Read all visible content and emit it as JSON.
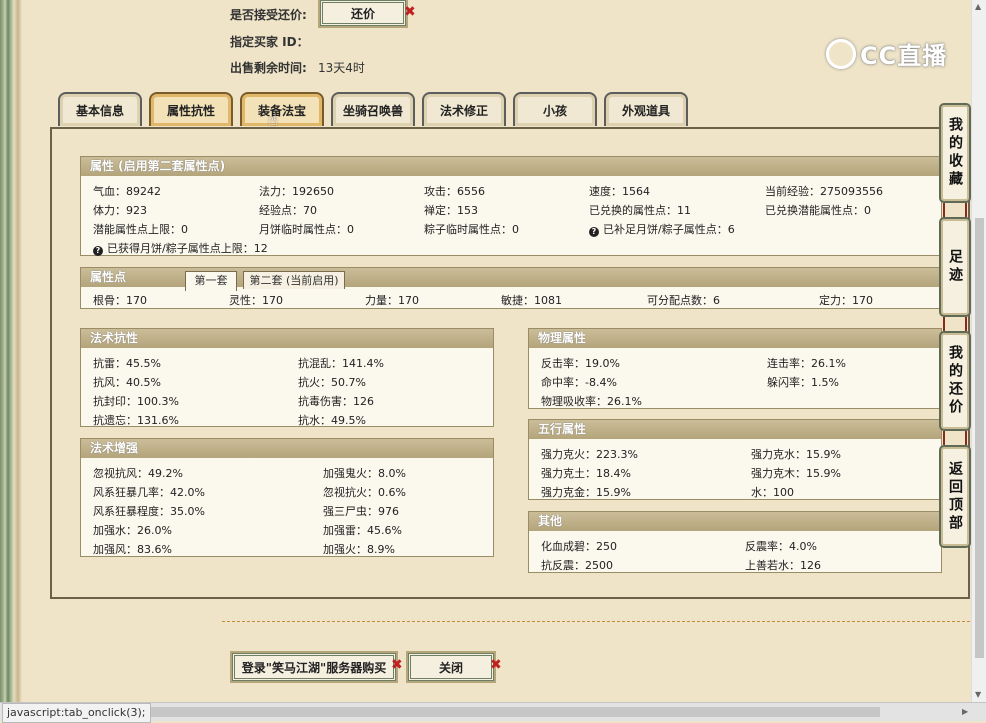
{
  "header": {
    "accept_counteroffer_label": "是否接受还价:",
    "counteroffer_button": "还价",
    "buyer_id_label": "指定买家 ID：",
    "remaining_time_label": "出售剩余时间:",
    "remaining_time_value": "13天4时"
  },
  "logo": {
    "text": "CC直播"
  },
  "tabs": [
    {
      "label": "基本信息"
    },
    {
      "label": "属性抗性"
    },
    {
      "label": "装备法宝"
    },
    {
      "label": "坐骑召唤兽"
    },
    {
      "label": "法术修正"
    },
    {
      "label": "小孩"
    },
    {
      "label": "外观道具"
    }
  ],
  "attributes": {
    "title": "属性 (启用第二套属性点)",
    "row1": [
      "气血：89242",
      "法力：192650",
      "攻击：6556",
      "速度：1564",
      "当前经验：275093556"
    ],
    "row2": [
      "体力：923",
      "经验点：70",
      "禅定：153",
      "已兑换的属性点：11",
      "已兑换潜能属性点：0"
    ],
    "row3": [
      "潜能属性点上限：0",
      "月饼临时属性点：0",
      "粽子临时属性点：0",
      "已补足月饼/粽子属性点：6"
    ],
    "row4": "已获得月饼/粽子属性点上限：12"
  },
  "attribute_points": {
    "title": "属性点",
    "subtab1": "第一套",
    "subtab2": "第二套 (当前启用)",
    "values": [
      "根骨：170",
      "灵性：170",
      "力量：170",
      "敏捷：1081",
      "可分配点数：6",
      "定力：170"
    ]
  },
  "spell_resist": {
    "title": "法术抗性",
    "left": [
      "抗雷：45.5%",
      "抗风：40.5%",
      "抗封印：100.3%",
      "抗遗忘：131.6%"
    ],
    "right": [
      "抗混乱：141.4%",
      "抗火：50.7%",
      "抗毒伤害：126",
      "抗水：49.5%"
    ]
  },
  "spell_boost": {
    "title": "法术增强",
    "left": [
      "忽视抗风：49.2%",
      "风系狂暴几率：42.0%",
      "风系狂暴程度：35.0%",
      "加强水：26.0%",
      "加强风：83.6%"
    ],
    "right": [
      "加强鬼火：8.0%",
      "忽视抗火：0.6%",
      "强三尸虫：976",
      "加强雷：45.6%",
      "加强火：8.9%"
    ]
  },
  "physical": {
    "title": "物理属性",
    "left": [
      "反击率：19.0%",
      "命中率：-8.4%",
      "物理吸收率：26.1%"
    ],
    "right": [
      "连击率：26.1%",
      "躲闪率：1.5%"
    ]
  },
  "elements": {
    "title": "五行属性",
    "left": [
      "强力克火：223.3%",
      "强力克土：18.4%",
      "强力克金：15.9%"
    ],
    "right": [
      "强力克水：15.9%",
      "强力克木：15.9%",
      "水：100"
    ]
  },
  "other": {
    "title": "其他",
    "left": [
      "化血成碧：250",
      "抗反震：2500"
    ],
    "right": [
      "反震率：4.0%",
      "上善若水：126"
    ]
  },
  "side_buttons": {
    "favorites": "我的收藏",
    "footprints": "足迹",
    "my_offers": "我的还价",
    "back_top": "返回顶部"
  },
  "bottom_buttons": {
    "login_buy": "登录\"笑马江湖\"服务器购买",
    "close": "关闭"
  },
  "status_bar": {
    "text": "javascript:tab_onclick(3);"
  },
  "colors": {
    "accent": "#e1b869",
    "panel_head": "#b3a47b",
    "button_border": "#6f7f66",
    "close_x": "#c02020"
  }
}
